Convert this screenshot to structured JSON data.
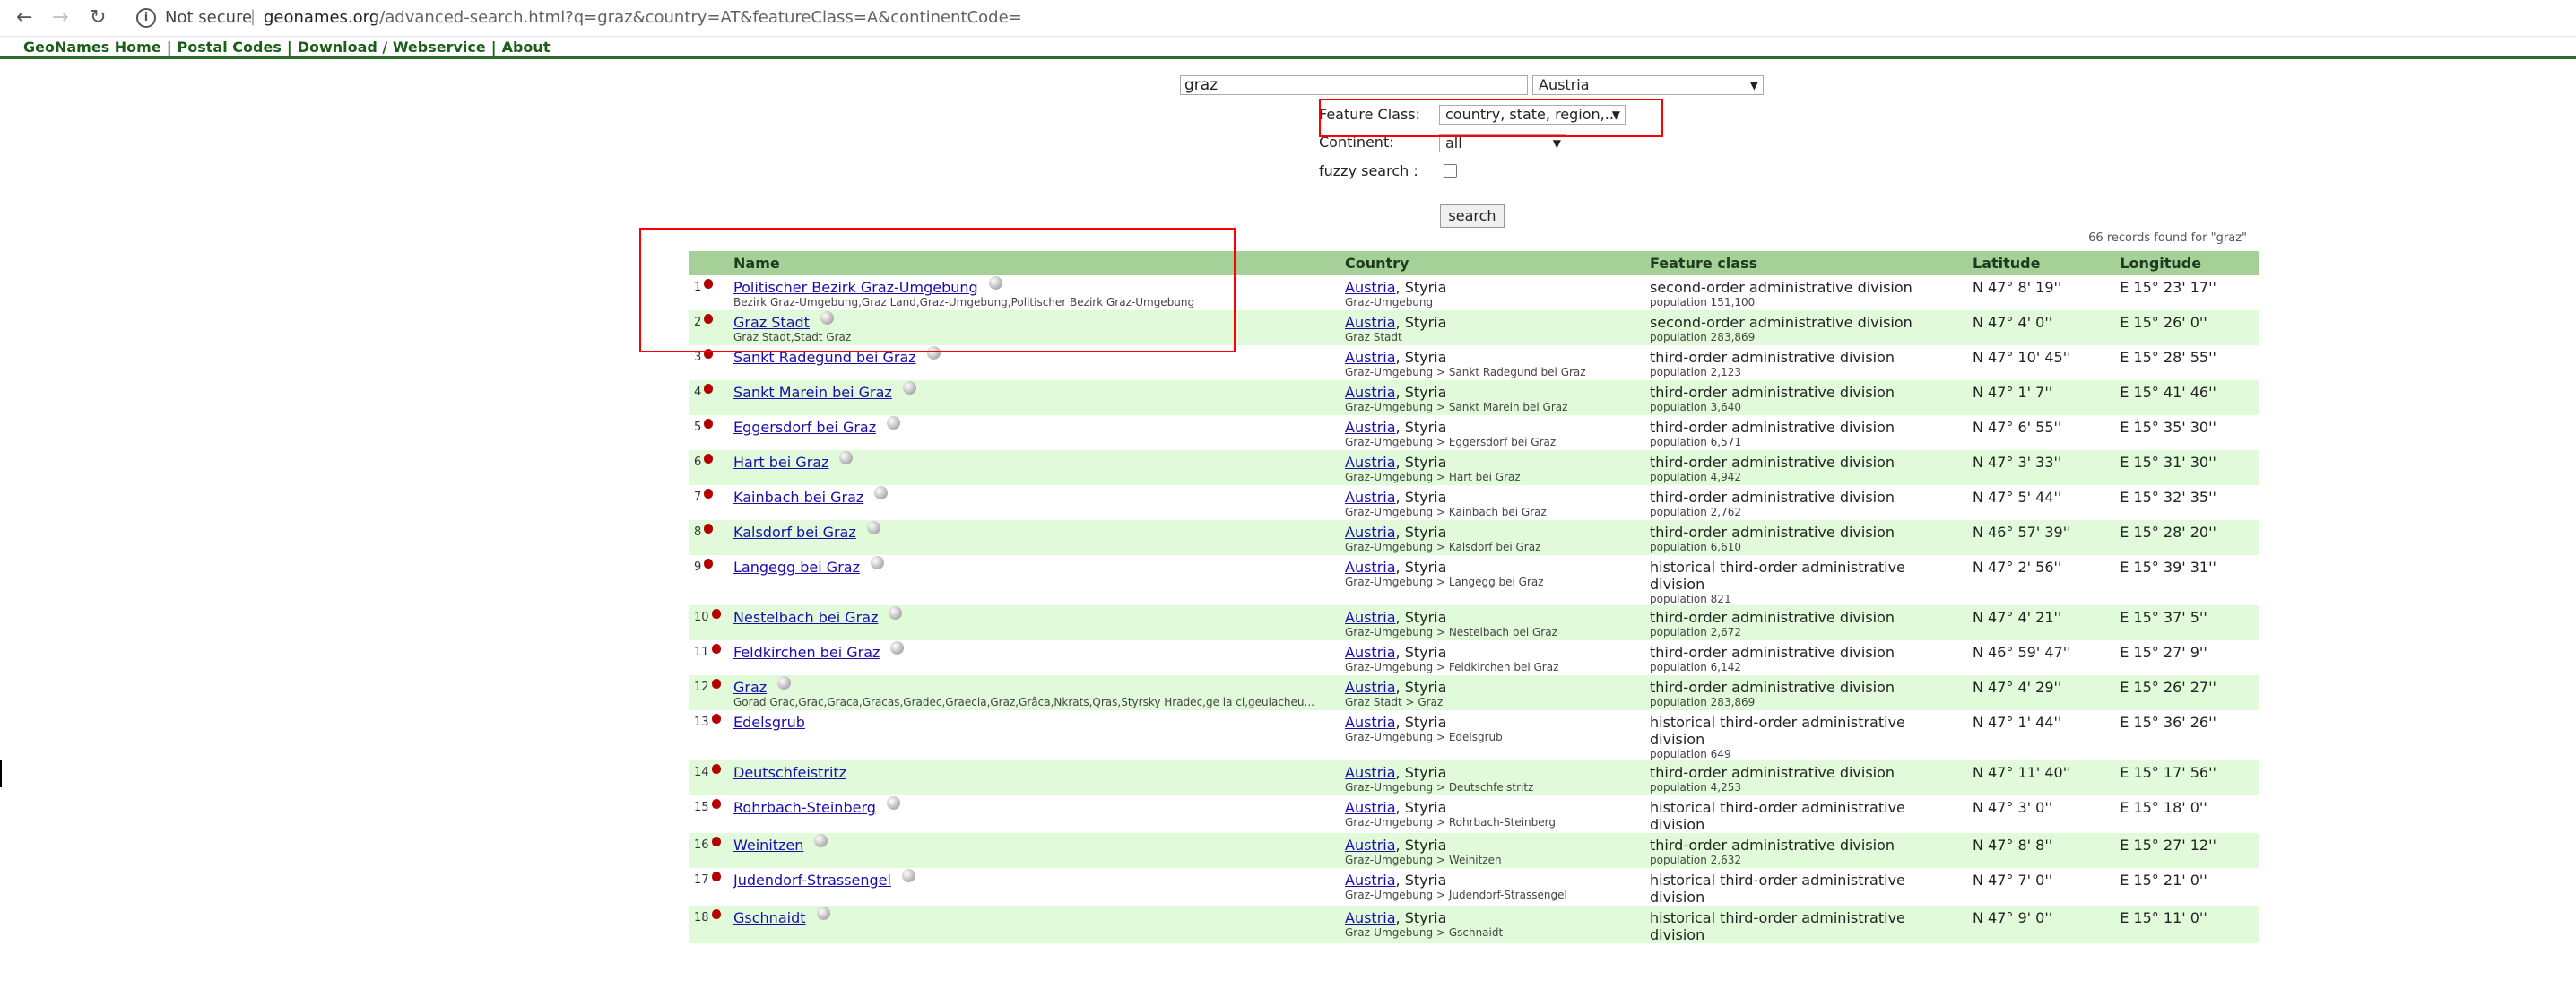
{
  "browser": {
    "back_icon": "←",
    "forward_icon": "→",
    "reload_icon": "↻",
    "info_icon": "i",
    "security_text": "Not secure",
    "separator": "|",
    "url_domain": "geonames.org",
    "url_path": "/advanced-search.html?q=graz&country=AT&featureClass=A&continentCode="
  },
  "nav": {
    "links": [
      "GeoNames Home",
      "Postal Codes",
      "Download / Webservice",
      "About"
    ],
    "separator": "|"
  },
  "search": {
    "query": "graz",
    "country_selected": "Austria",
    "feature_class_label": "Feature Class:",
    "feature_class_selected": "country, state, region,...",
    "continent_label": "Continent:",
    "continent_selected": "all",
    "fuzzy_label": "fuzzy search :",
    "button_label": "search",
    "dropdown_arrow": "▼"
  },
  "results": {
    "summary": "66 records found for \"graz\"",
    "headers": [
      "Name",
      "Country",
      "Feature class",
      "Latitude",
      "Longitude"
    ],
    "rows": [
      {
        "num": "1",
        "name": "Politischer Bezirk Graz-Umgebung",
        "alt": "Bezirk Graz-Umgebung,Graz Land,Graz-Umgebung,Politischer Bezirk Graz-Umgebung",
        "country": "Austria",
        "region": ", Styria",
        "path": "Graz-Umgebung",
        "fclass": "second-order administrative division",
        "pop": "population 151,100",
        "lat": "N 47° 8' 19''",
        "lon": "E 15° 23' 17''"
      },
      {
        "num": "2",
        "name": "Graz Stadt",
        "alt": "Graz Stadt,Stadt Graz",
        "country": "Austria",
        "region": ", Styria",
        "path": "Graz Stadt",
        "fclass": "second-order administrative division",
        "pop": "population 283,869",
        "lat": "N 47° 4' 0''",
        "lon": "E 15° 26' 0''"
      },
      {
        "num": "3",
        "name": "Sankt Radegund bei Graz",
        "alt": "",
        "country": "Austria",
        "region": ", Styria",
        "path": "Graz-Umgebung > Sankt Radegund bei Graz",
        "fclass": "third-order administrative division",
        "pop": "population 2,123",
        "lat": "N 47° 10' 45''",
        "lon": "E 15° 28' 55''"
      },
      {
        "num": "4",
        "name": "Sankt Marein bei Graz",
        "alt": "",
        "country": "Austria",
        "region": ", Styria",
        "path": "Graz-Umgebung > Sankt Marein bei Graz",
        "fclass": "third-order administrative division",
        "pop": "population 3,640",
        "lat": "N 47° 1' 7''",
        "lon": "E 15° 41' 46''"
      },
      {
        "num": "5",
        "name": "Eggersdorf bei Graz",
        "alt": "",
        "country": "Austria",
        "region": ", Styria",
        "path": "Graz-Umgebung > Eggersdorf bei Graz",
        "fclass": "third-order administrative division",
        "pop": "population 6,571",
        "lat": "N 47° 6' 55''",
        "lon": "E 15° 35' 30''"
      },
      {
        "num": "6",
        "name": "Hart bei Graz",
        "alt": "",
        "country": "Austria",
        "region": ", Styria",
        "path": "Graz-Umgebung > Hart bei Graz",
        "fclass": "third-order administrative division",
        "pop": "population 4,942",
        "lat": "N 47° 3' 33''",
        "lon": "E 15° 31' 30''"
      },
      {
        "num": "7",
        "name": "Kainbach bei Graz",
        "alt": "",
        "country": "Austria",
        "region": ", Styria",
        "path": "Graz-Umgebung > Kainbach bei Graz",
        "fclass": "third-order administrative division",
        "pop": "population 2,762",
        "lat": "N 47° 5' 44''",
        "lon": "E 15° 32' 35''"
      },
      {
        "num": "8",
        "name": "Kalsdorf bei Graz",
        "alt": "",
        "country": "Austria",
        "region": ", Styria",
        "path": "Graz-Umgebung > Kalsdorf bei Graz",
        "fclass": "third-order administrative division",
        "pop": "population 6,610",
        "lat": "N 46° 57' 39''",
        "lon": "E 15° 28' 20''"
      },
      {
        "num": "9",
        "name": "Langegg bei Graz",
        "alt": "",
        "country": "Austria",
        "region": ", Styria",
        "path": "Graz-Umgebung > Langegg bei Graz",
        "fclass": "historical third-order administrative division",
        "pop": "population 821",
        "lat": "N 47° 2' 56''",
        "lon": "E 15° 39' 31''"
      },
      {
        "num": "10",
        "name": "Nestelbach bei Graz",
        "alt": "",
        "country": "Austria",
        "region": ", Styria",
        "path": "Graz-Umgebung > Nestelbach bei Graz",
        "fclass": "third-order administrative division",
        "pop": "population 2,672",
        "lat": "N 47° 4' 21''",
        "lon": "E 15° 37' 5''"
      },
      {
        "num": "11",
        "name": "Feldkirchen bei Graz",
        "alt": "",
        "country": "Austria",
        "region": ", Styria",
        "path": "Graz-Umgebung > Feldkirchen bei Graz",
        "fclass": "third-order administrative division",
        "pop": "population 6,142",
        "lat": "N 46° 59' 47''",
        "lon": "E 15° 27' 9''"
      },
      {
        "num": "12",
        "name": "Graz",
        "alt": "Gorad Grac,Grac,Graca,Gracas,Gradec,Graecia,Graz,Grâca,Nkrats,Qras,Styrsky Hradec,ge la ci,geulacheu...",
        "country": "Austria",
        "region": ", Styria",
        "path": "Graz Stadt > Graz",
        "fclass": "third-order administrative division",
        "pop": "population 283,869",
        "lat": "N 47° 4' 29''",
        "lon": "E 15° 26' 27''"
      },
      {
        "num": "13",
        "name": "Edelsgrub",
        "alt": "",
        "country": "Austria",
        "region": ", Styria",
        "path": "Graz-Umgebung > Edelsgrub",
        "fclass": "historical third-order administrative division",
        "pop": "population 649",
        "lat": "N 47° 1' 44''",
        "lon": "E 15° 36' 26''"
      },
      {
        "num": "14",
        "name": "Deutschfeistritz",
        "alt": "",
        "country": "Austria",
        "region": ", Styria",
        "path": "Graz-Umgebung > Deutschfeistritz",
        "fclass": "third-order administrative division",
        "pop": "population 4,253",
        "lat": "N 47° 11' 40''",
        "lon": "E 15° 17' 56''"
      },
      {
        "num": "15",
        "name": "Rohrbach-Steinberg",
        "alt": "",
        "country": "Austria",
        "region": ", Styria",
        "path": "Graz-Umgebung > Rohrbach-Steinberg",
        "fclass": "historical third-order administrative division",
        "pop": "",
        "lat": "N 47° 3' 0''",
        "lon": "E 15° 18' 0''"
      },
      {
        "num": "16",
        "name": "Weinitzen",
        "alt": "",
        "country": "Austria",
        "region": ", Styria",
        "path": "Graz-Umgebung > Weinitzen",
        "fclass": "third-order administrative division",
        "pop": "population 2,632",
        "lat": "N 47° 8' 8''",
        "lon": "E 15° 27' 12''"
      },
      {
        "num": "17",
        "name": "Judendorf-Strassengel",
        "alt": "",
        "country": "Austria",
        "region": ", Styria",
        "path": "Graz-Umgebung > Judendorf-Strassengel",
        "fclass": "historical third-order administrative division",
        "pop": "",
        "lat": "N 47° 7' 0''",
        "lon": "E 15° 21' 0''"
      },
      {
        "num": "18",
        "name": "Gschnaidt",
        "alt": "",
        "country": "Austria",
        "region": ", Styria",
        "path": "Graz-Umgebung > Gschnaidt",
        "fclass": "historical third-order administrative division",
        "pop": "",
        "lat": "N 47° 9' 0''",
        "lon": "E 15° 11' 0''"
      }
    ]
  },
  "colors": {
    "header_bg": "#a5d098",
    "even_row_bg": "#e1fbda",
    "marker": "#b30000",
    "annotation": "#ff0000",
    "nav_text": "#1a5e1a"
  }
}
